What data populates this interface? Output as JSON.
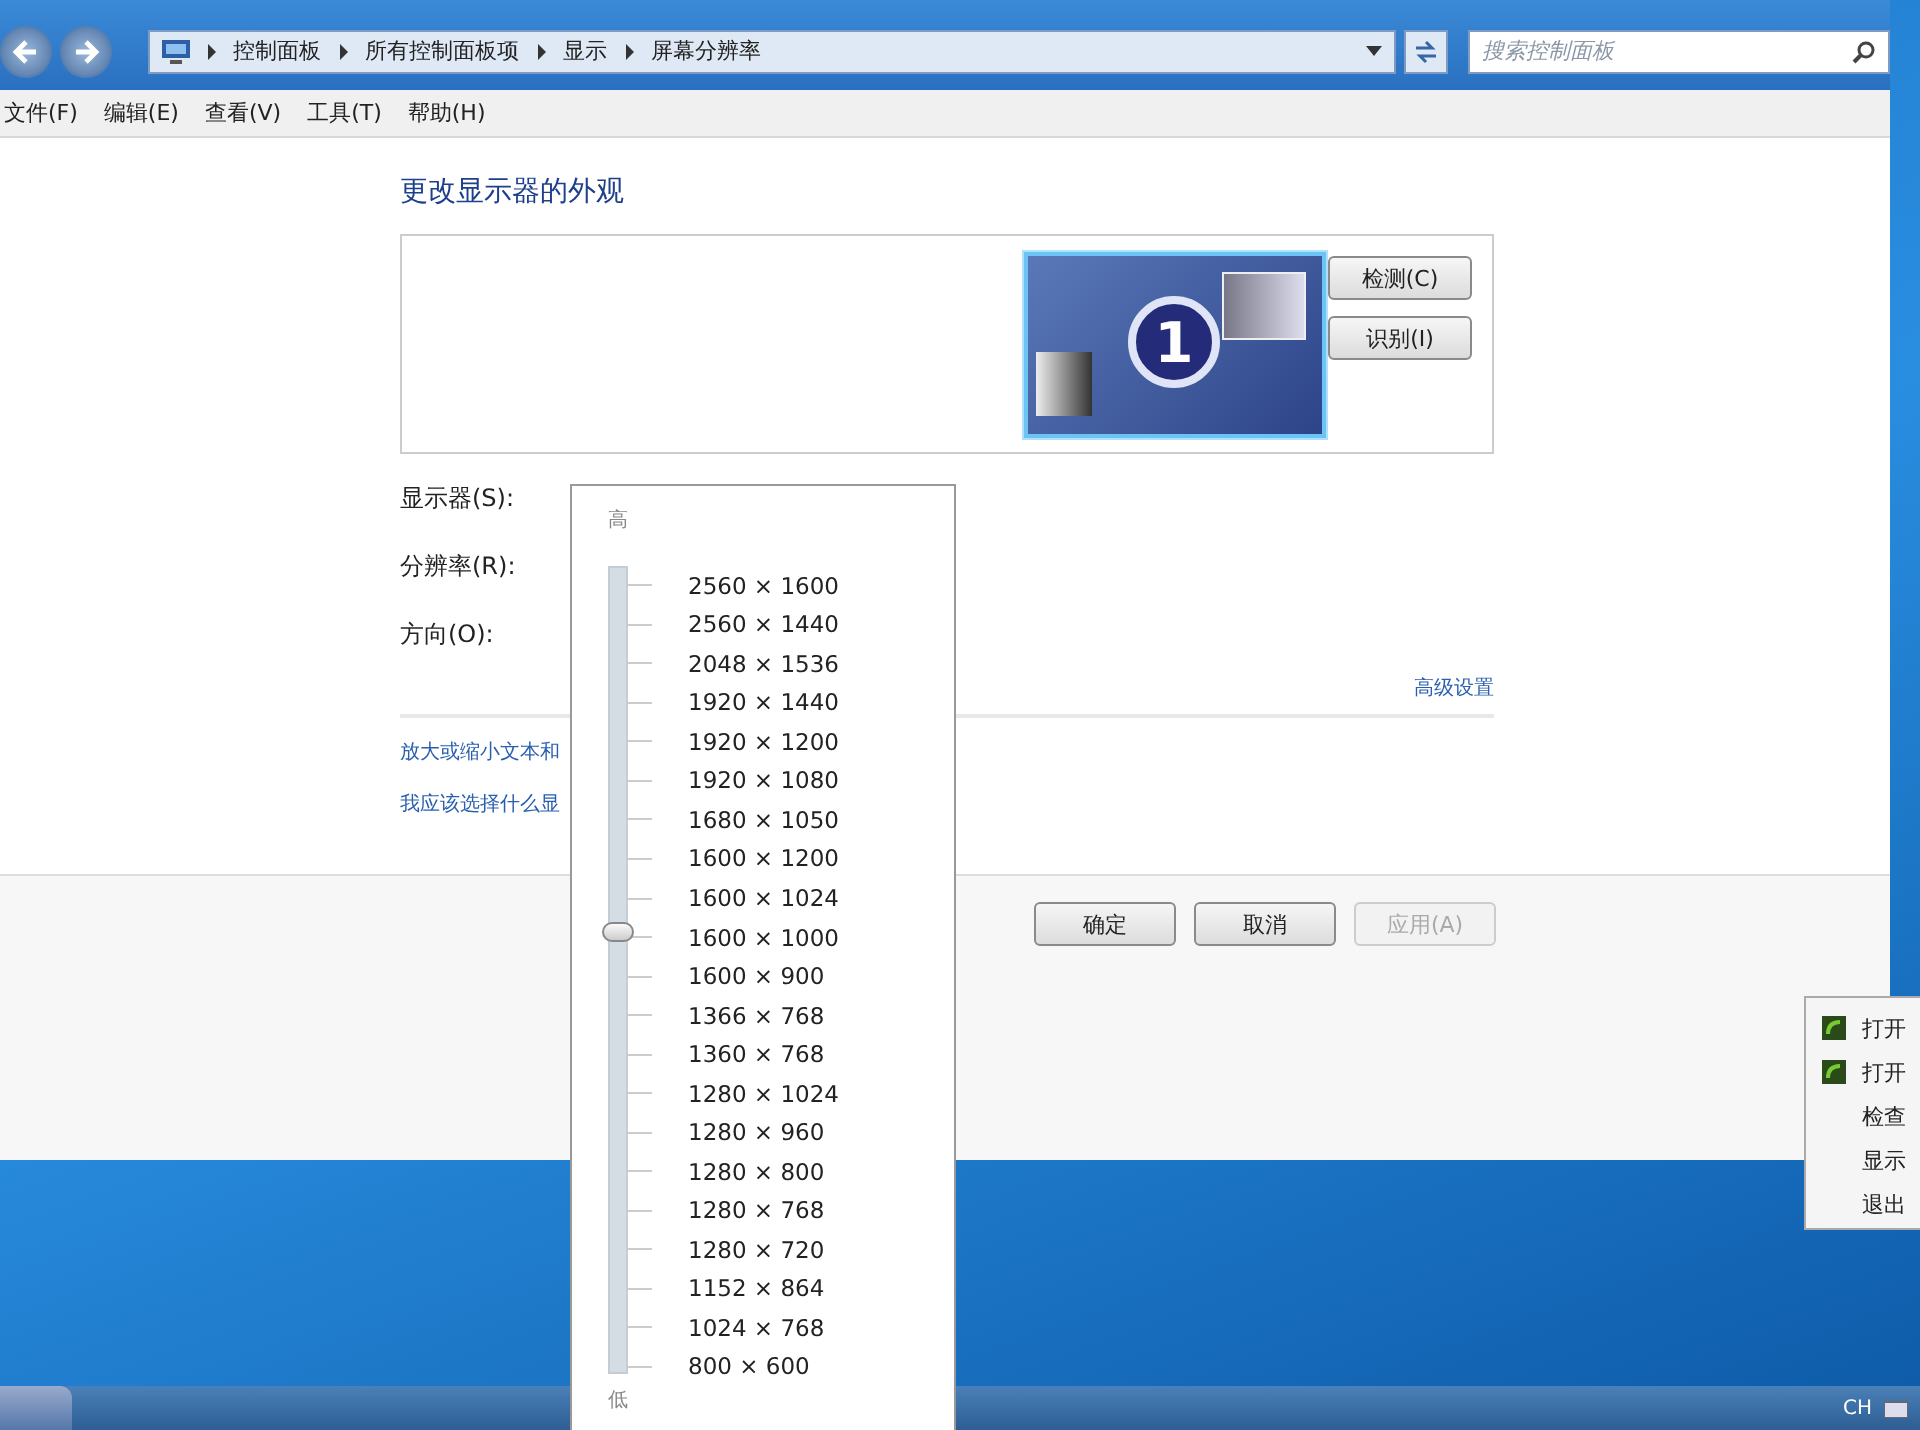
{
  "address_bar": {
    "path": [
      "控制面板",
      "所有控制面板项",
      "显示",
      "屏幕分辨率"
    ]
  },
  "search": {
    "placeholder": "搜索控制面板"
  },
  "menu_bar": [
    "文件(F)",
    "编辑(E)",
    "查看(V)",
    "工具(T)",
    "帮助(H)"
  ],
  "heading": "更改显示器的外观",
  "monitor": {
    "number": "1",
    "selected": true
  },
  "side_buttons": [
    "检测(C)",
    "识别(I)"
  ],
  "settings": [
    {
      "label": "显示器(S):"
    },
    {
      "label": "分辨率(R):"
    },
    {
      "label": "方向(O):"
    }
  ],
  "advanced_link": "高级设置",
  "links": [
    "放大或缩小文本和",
    "我应该选择什么显"
  ],
  "footer_buttons": [
    {
      "label": "确定",
      "disabled": false
    },
    {
      "label": "取消",
      "disabled": false
    },
    {
      "label": "应用(A)",
      "disabled": true
    }
  ],
  "resolution_dropdown": {
    "high_label": "高",
    "low_label": "低",
    "level": 0.55,
    "options": [
      "2560 × 1600",
      "2560 × 1440",
      "2048 × 1536",
      "1920 × 1440",
      "1920 × 1200",
      "1920 × 1080",
      "1680 × 1050",
      "1600 × 1200",
      "1600 × 1024",
      "1600 × 1000",
      "1600 × 900",
      "1366 × 768",
      "1360 × 768",
      "1280 × 1024",
      "1280 × 960",
      "1280 × 800",
      "1280 × 768",
      "1280 × 720",
      "1152 × 864",
      "1024 × 768",
      "800 × 600"
    ]
  },
  "context_menu": [
    {
      "label": "打开",
      "icon": true
    },
    {
      "label": "打开",
      "icon": true
    },
    {
      "label": "检查",
      "icon": false
    },
    {
      "label": "显示",
      "icon": false
    },
    {
      "label": "退出",
      "icon": false
    }
  ],
  "taskbar": {
    "language": "CH"
  }
}
